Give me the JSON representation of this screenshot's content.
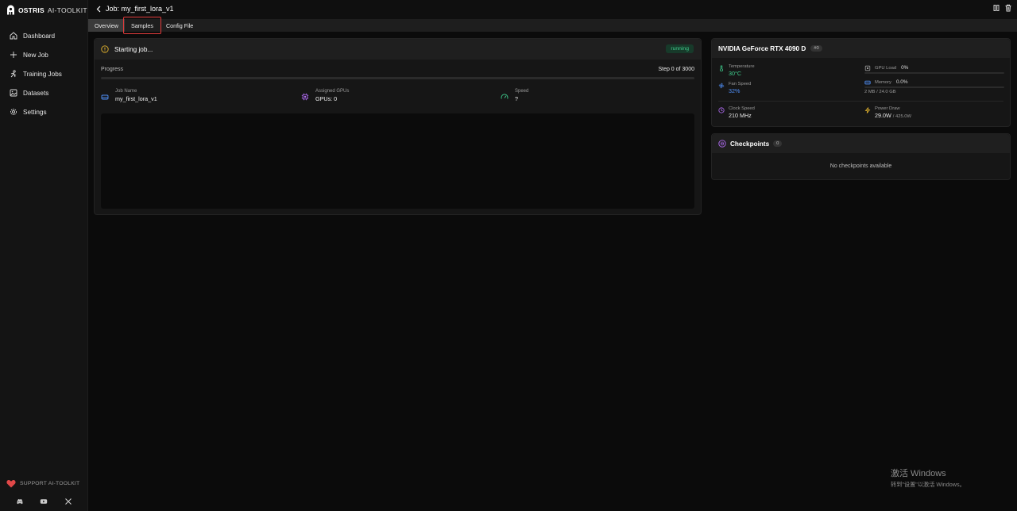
{
  "app": {
    "brand": "OSTRIS",
    "subtitle": "AI-TOOLKIT"
  },
  "sidebar": {
    "items": [
      {
        "label": "Dashboard",
        "icon": "home-icon"
      },
      {
        "label": "New Job",
        "icon": "plus-icon"
      },
      {
        "label": "Training Jobs",
        "icon": "training-icon"
      },
      {
        "label": "Datasets",
        "icon": "images-icon"
      },
      {
        "label": "Settings",
        "icon": "gear-icon"
      }
    ],
    "support_label": "SUPPORT AI-TOOLKIT",
    "socials": [
      "discord-icon",
      "youtube-icon",
      "x-icon"
    ]
  },
  "header": {
    "title": "Job: my_first_lora_v1"
  },
  "tabs": [
    {
      "label": "Overview",
      "active": true
    },
    {
      "label": "Samples",
      "active": false,
      "highlighted": true
    },
    {
      "label": "Config File",
      "active": false
    }
  ],
  "job": {
    "status_text": "Starting job...",
    "status_badge": "running",
    "progress_label": "Progress",
    "step_text": "Step 0 of 3000",
    "progress_fraction": 0,
    "job_name_label": "Job Name",
    "job_name": "my_first_lora_v1",
    "gpus_label": "Assigned GPUs",
    "gpus_value": "GPUs: 0",
    "speed_label": "Speed",
    "speed_value": "?"
  },
  "gpu": {
    "name": "NVIDIA GeForce RTX 4090 D",
    "index_badge": "#0",
    "temperature_label": "Temperature",
    "temperature_value": "30°C",
    "gpu_load_label": "GPU Load",
    "gpu_load_value": "0%",
    "gpu_load_fraction": 0,
    "fan_label": "Fan Speed",
    "fan_value": "32%",
    "memory_label": "Memory",
    "memory_value": "0.0%",
    "memory_fraction": 0,
    "memory_detail": "2 MB / 24.0 GB",
    "clock_label": "Clock Speed",
    "clock_value": "210 MHz",
    "power_label": "Power Draw",
    "power_value": "29.0W",
    "power_limit": "/ 425.0W"
  },
  "checkpoints": {
    "title": "Checkpoints",
    "count": "0",
    "empty_text": "No checkpoints available"
  },
  "watermark": {
    "line1": "激活 Windows",
    "line2": "转到\"设置\"以激活 Windows。"
  },
  "colors": {
    "running_green": "#3fcf8e",
    "temp_green": "#3fcf8e",
    "fan_blue": "#4f8ff7",
    "highlight_red": "#e33b3b"
  }
}
